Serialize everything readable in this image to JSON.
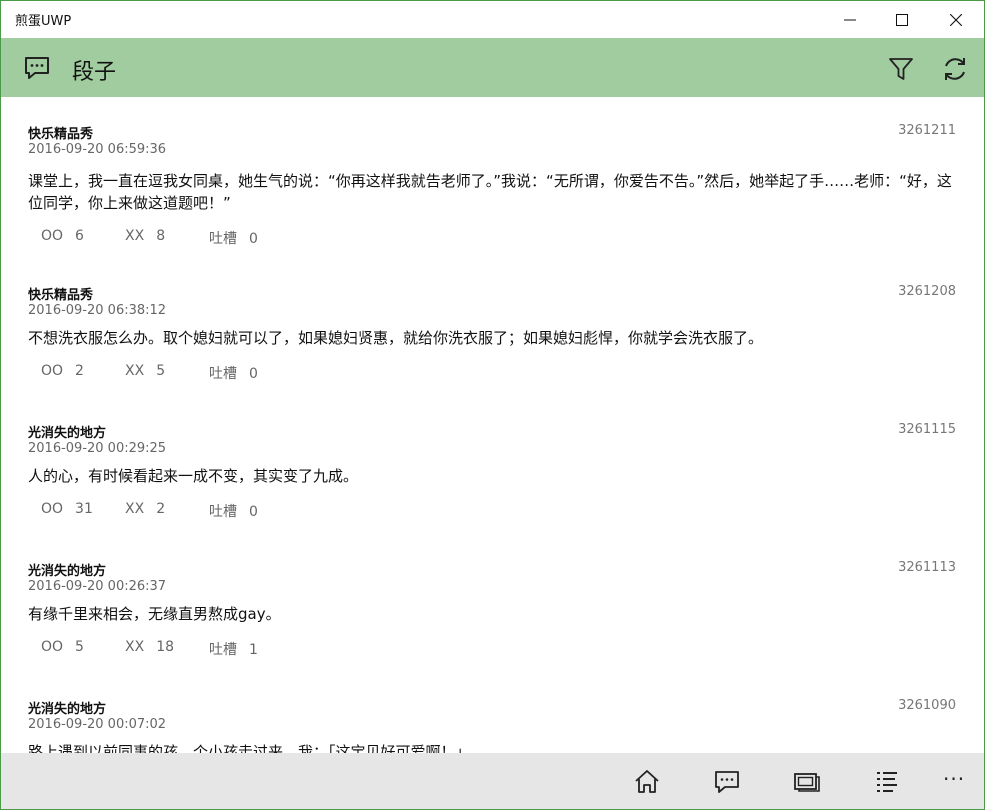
{
  "window": {
    "title": "煎蛋UWP"
  },
  "header": {
    "title": "段子"
  },
  "posts": [
    {
      "author": "快乐精品秀",
      "time": "2016-09-20 06:59:36",
      "id": "3261211",
      "content": "课堂上，我一直在逗我女同桌，她生气的说：“你再这样我就告老师了。”我说：“无所谓，你爱告不告。”然后，她举起了手……老师：“好，这位同学，你上来做这道题吧！”",
      "oo_label": "OO",
      "oo": "6",
      "xx_label": "XX",
      "xx": "8",
      "tucao_label": "吐槽",
      "tucao": "0"
    },
    {
      "author": "快乐精品秀",
      "time": "2016-09-20 06:38:12",
      "id": "3261208",
      "content": "不想洗衣服怎么办。取个媳妇就可以了，如果媳妇贤惠，就给你洗衣服了；如果媳妇彪悍，你就学会洗衣服了。",
      "oo_label": "OO",
      "oo": "2",
      "xx_label": "XX",
      "xx": "5",
      "tucao_label": "吐槽",
      "tucao": "0"
    },
    {
      "author": "光消失的地方",
      "time": "2016-09-20 00:29:25",
      "id": "3261115",
      "content": "人的心，有时候看起来一成不变，其实变了九成。",
      "oo_label": "OO",
      "oo": "31",
      "xx_label": "XX",
      "xx": "2",
      "tucao_label": "吐槽",
      "tucao": "0"
    },
    {
      "author": "光消失的地方",
      "time": "2016-09-20 00:26:37",
      "id": "3261113",
      "content": "有缘千里来相会，无缘直男熬成gay。",
      "oo_label": "OO",
      "oo": "5",
      "xx_label": "XX",
      "xx": "18",
      "tucao_label": "吐槽",
      "tucao": "1"
    },
    {
      "author": "光消失的地方",
      "time": "2016-09-20 00:07:02",
      "id": "3261090",
      "content": "路上遇到以前同事的孩，个小孩走过来，我：「这宝贝好可爱啊！」"
    }
  ],
  "appbar": {
    "more": "···"
  },
  "colors": {
    "header_bg": "#a0cc9f",
    "appbar_bg": "#e6e6e6",
    "border": "#4a9a4a"
  },
  "icons": {
    "header_left": "chat-bubble-icon",
    "header_right": [
      "filter-icon",
      "refresh-icon"
    ],
    "appbar": [
      "home-icon",
      "chat-bubble-icon",
      "slideshow-icon",
      "list-icon",
      "more-icon"
    ],
    "window": [
      "minimize-icon",
      "maximize-icon",
      "close-icon"
    ]
  }
}
